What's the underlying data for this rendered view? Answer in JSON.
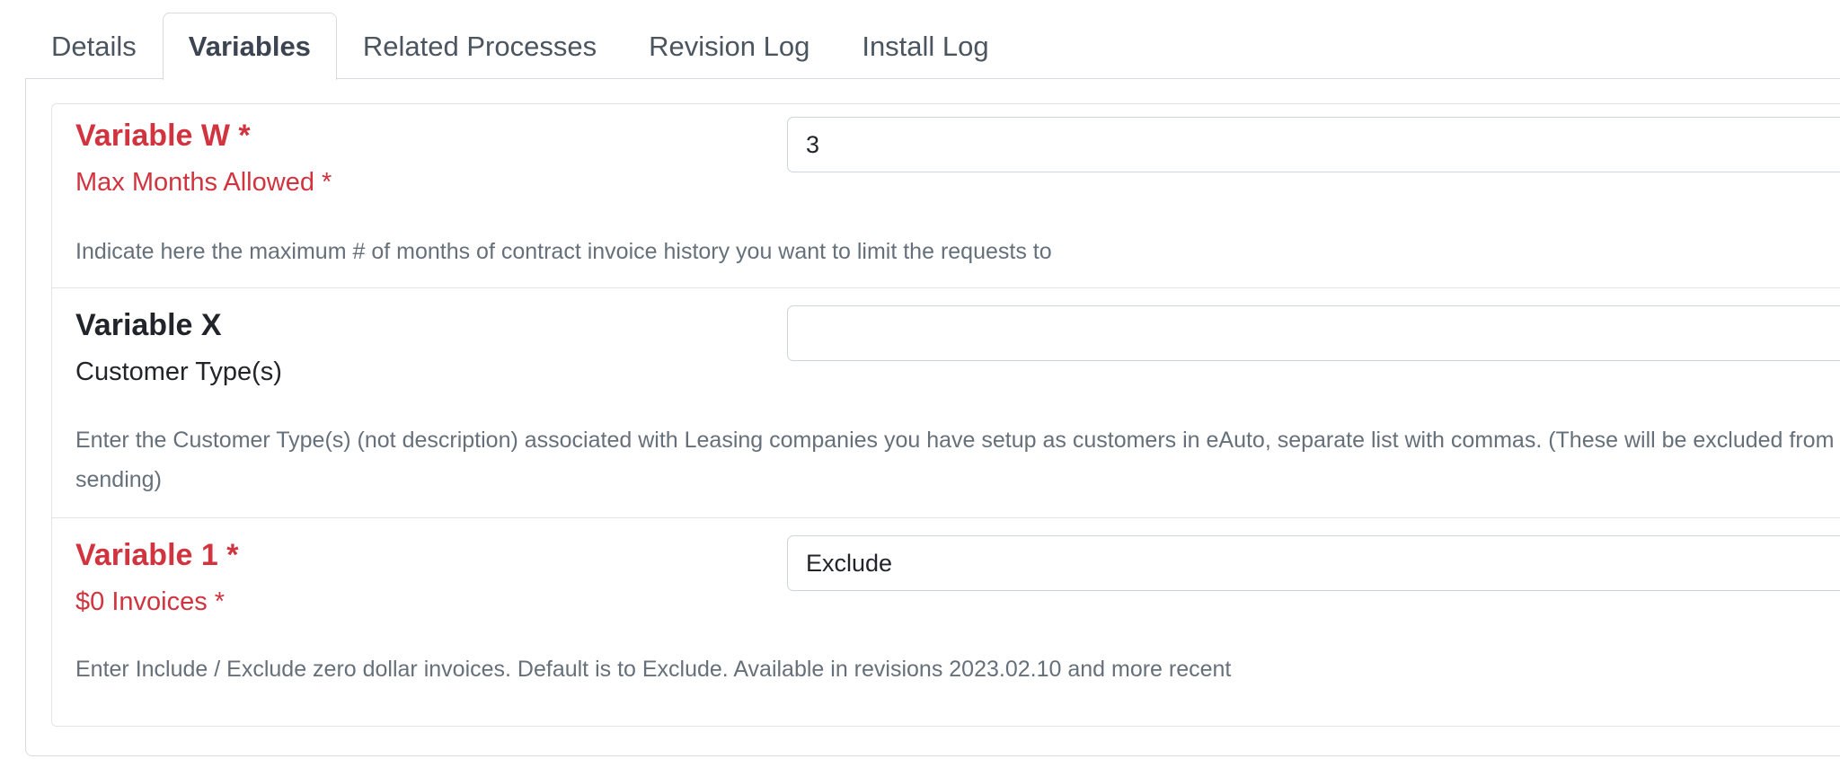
{
  "tabs": [
    {
      "label": "Details",
      "active": false
    },
    {
      "label": "Variables",
      "active": true
    },
    {
      "label": "Related Processes",
      "active": false
    },
    {
      "label": "Revision Log",
      "active": false
    },
    {
      "label": "Install Log",
      "active": false
    }
  ],
  "variables": [
    {
      "title": "Variable W *",
      "name": "Max Months Allowed *",
      "value": "3",
      "description": "Indicate here the maximum # of months of contract invoice history you want to limit the requests to",
      "required": true
    },
    {
      "title": "Variable X",
      "name": "Customer Type(s)",
      "value": "",
      "description": "Enter the Customer Type(s) (not description) associated with Leasing companies you have setup as customers in eAuto, separate list with commas.  (These will be excluded from sending)",
      "required": false
    },
    {
      "title": "Variable 1 *",
      "name": "$0 Invoices *",
      "value": "Exclude",
      "description": "Enter Include / Exclude zero dollar invoices. Default is to Exclude. Available in revisions 2023.02.10 and more recent",
      "required": true
    }
  ],
  "colors": {
    "required": "#d1343f",
    "description": "#66707a",
    "border": "#d7dbdf"
  }
}
